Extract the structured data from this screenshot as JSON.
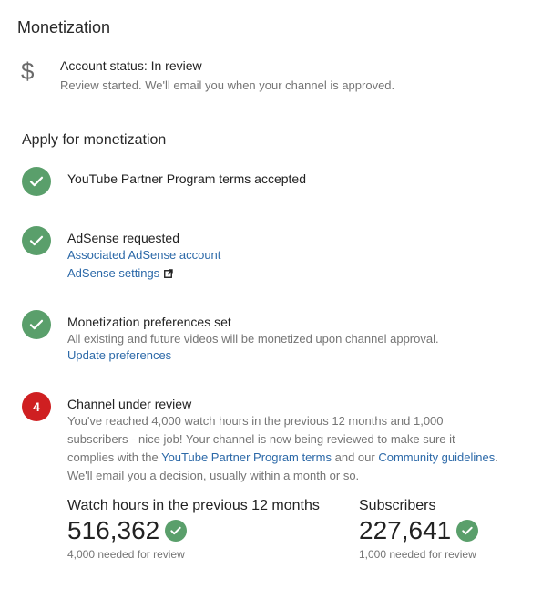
{
  "page": {
    "title": "Monetization"
  },
  "account": {
    "icon": "dollar-icon",
    "status": "Account status: In review",
    "message": "Review started. We'll email you when your channel is approved."
  },
  "apply": {
    "title": "Apply for monetization",
    "steps": [
      {
        "state": "done",
        "icon": "check-circle-icon",
        "title": "YouTube Partner Program terms accepted"
      },
      {
        "state": "done",
        "icon": "check-circle-icon",
        "title": "AdSense requested",
        "links": [
          "Associated AdSense account",
          "AdSense settings"
        ]
      },
      {
        "state": "done",
        "icon": "check-circle-icon",
        "title": "Monetization preferences set",
        "description": "All existing and future videos will be monetized upon channel approval.",
        "link": "Update preferences"
      },
      {
        "state": "pending",
        "number": "4",
        "title": "Channel under review",
        "description_parts": {
          "line1": "You've reached 4,000 watch hours in the previous 12 months and 1,000",
          "line2": "subscribers - nice job! Your channel is now being reviewed to make sure it",
          "line3_a": "complies with the ",
          "line3_link1": "YouTube Partner Program terms",
          "line3_b": " and our ",
          "line3_link2": "Community guidelines",
          "line3_c": ".",
          "line4": "We'll email you a decision, usually within a month or so."
        }
      }
    ]
  },
  "metrics": {
    "watch_hours": {
      "label": "Watch hours in the previous 12 months",
      "value": "516,362",
      "note": "4,000 needed for review"
    },
    "subscribers": {
      "label": "Subscribers",
      "value": "227,641",
      "note": "1,000 needed for review"
    }
  },
  "colors": {
    "success": "#5a9f6b",
    "danger": "#cf1f21",
    "link": "#2c69a8"
  }
}
